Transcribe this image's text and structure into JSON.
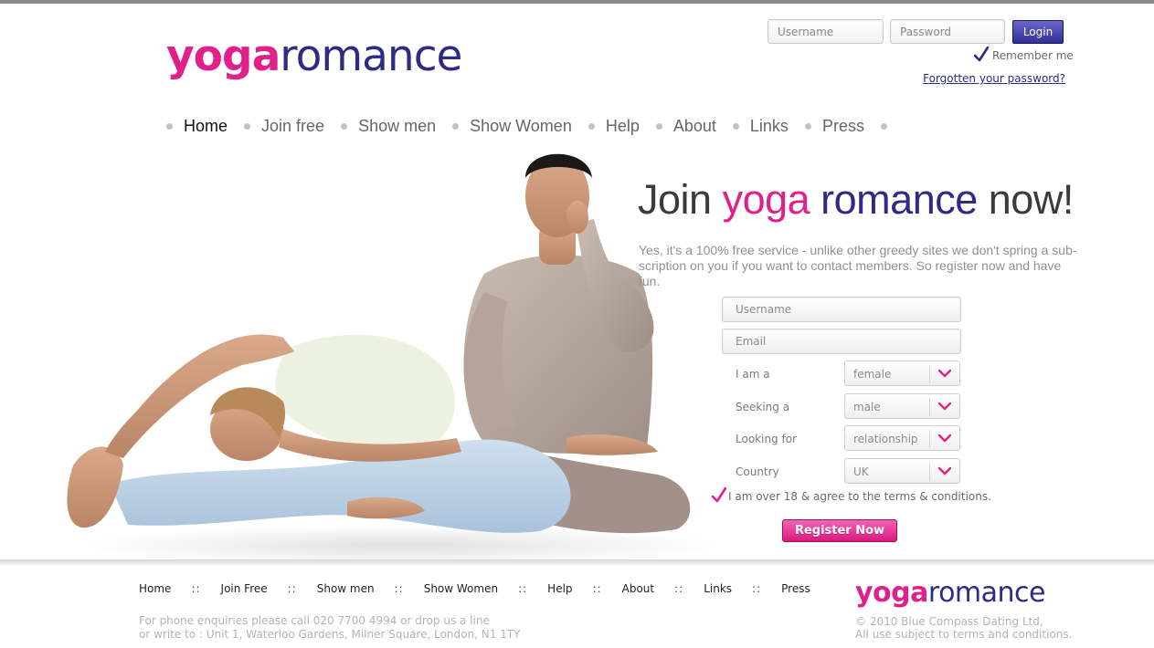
{
  "brand": {
    "logo_part1": "yoga",
    "logo_part2": "romance"
  },
  "login": {
    "username_placeholder": "Username",
    "password_placeholder": "Password",
    "login_label": "Login",
    "remember_label": "Remember me",
    "forgot_label": "Forgotten your password?"
  },
  "nav": {
    "items": [
      {
        "label": "Home"
      },
      {
        "label": "Join free"
      },
      {
        "label": "Show men"
      },
      {
        "label": "Show Women"
      },
      {
        "label": "Help"
      },
      {
        "label": "About"
      },
      {
        "label": "Links"
      },
      {
        "label": "Press"
      }
    ]
  },
  "hero": {
    "headline_part1": "Join ",
    "headline_part2": "yoga",
    "headline_part3": "romance",
    "headline_part4": "now!",
    "intro": "Yes, it's a 100% free service - unlike other greedy sites we don't spring a sub-scription on you if you want to contact members. So register now and have fun."
  },
  "register": {
    "username_placeholder": "Username",
    "email_placeholder": "Email",
    "fields": [
      {
        "label": "I am a",
        "value": "female"
      },
      {
        "label": "Seeking a",
        "value": "male"
      },
      {
        "label": "Looking for",
        "value": "relationship"
      },
      {
        "label": "Country",
        "value": "UK"
      }
    ],
    "agree_label": "I am over 18 & agree to the terms & conditions.",
    "register_label": "Register Now"
  },
  "footer": {
    "nav": [
      {
        "label": "Home"
      },
      {
        "label": "Join Free"
      },
      {
        "label": "Show men"
      },
      {
        "label": "Show Women"
      },
      {
        "label": "Help"
      },
      {
        "label": "About"
      },
      {
        "label": "Links"
      },
      {
        "label": "Press"
      }
    ],
    "separator": "::",
    "phone_line": "For phone enquiries please call 020 7700 4994 or drop us a line",
    "address_line": "or write to : Unit 1, Waterloo Gardens, Milner Square, London, N1 1TY",
    "copyright_line1": "© 2010 Blue Compass Dating Ltd,",
    "copyright_line2": "All use subject to terms and conditions."
  },
  "colors": {
    "pink": "#e0218a",
    "navy": "#2e2a86"
  }
}
